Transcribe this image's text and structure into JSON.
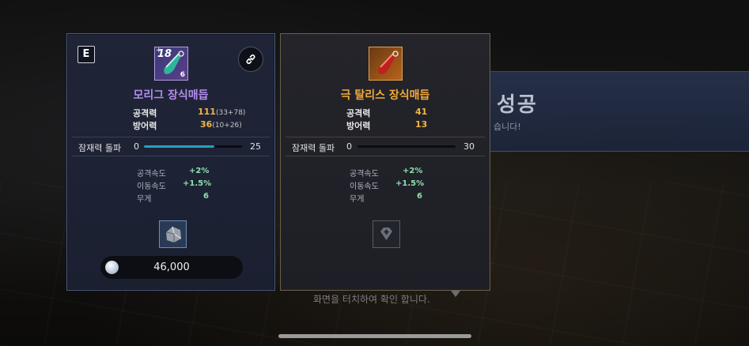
{
  "background": {
    "title": "성공",
    "subtitle": "습니다!",
    "hint": "화면을 터치하여 확인 합니다."
  },
  "left_card": {
    "grade": "E",
    "level": "18",
    "count": "6",
    "name": "모리그 장식매듭",
    "stats": [
      {
        "label": "공격력",
        "value": "111",
        "detail": "(33+78)"
      },
      {
        "label": "방어력",
        "value": "36",
        "detail": "(10+26)"
      }
    ],
    "potential": {
      "label": "잠재력 돌파",
      "min": "0",
      "max": "25",
      "progress": 0.72
    },
    "sub_stats": [
      {
        "label": "공격속도",
        "value": "+2%"
      },
      {
        "label": "이동속도",
        "value": "+1.5%"
      },
      {
        "label": "무게",
        "value": "6"
      }
    ],
    "price": "46,000",
    "icon": "chain-link-icon"
  },
  "right_card": {
    "name": "극 탈리스 장식매듭",
    "stats": [
      {
        "label": "공격력",
        "value": "41",
        "detail": ""
      },
      {
        "label": "방어력",
        "value": "13",
        "detail": ""
      }
    ],
    "potential": {
      "label": "잠재력 돌파",
      "min": "0",
      "max": "30",
      "progress": 0.0
    },
    "sub_stats": [
      {
        "label": "공격속도",
        "value": "+2%"
      },
      {
        "label": "이동속도",
        "value": "+1.5%"
      },
      {
        "label": "무게",
        "value": "6"
      }
    ]
  },
  "colors": {
    "left_name": "#b38cf0",
    "right_name": "#f2a93a",
    "stat_value": "#f1b54a",
    "sub_value": "#8fe0b0",
    "bar_fill": "#2a9fc0"
  }
}
